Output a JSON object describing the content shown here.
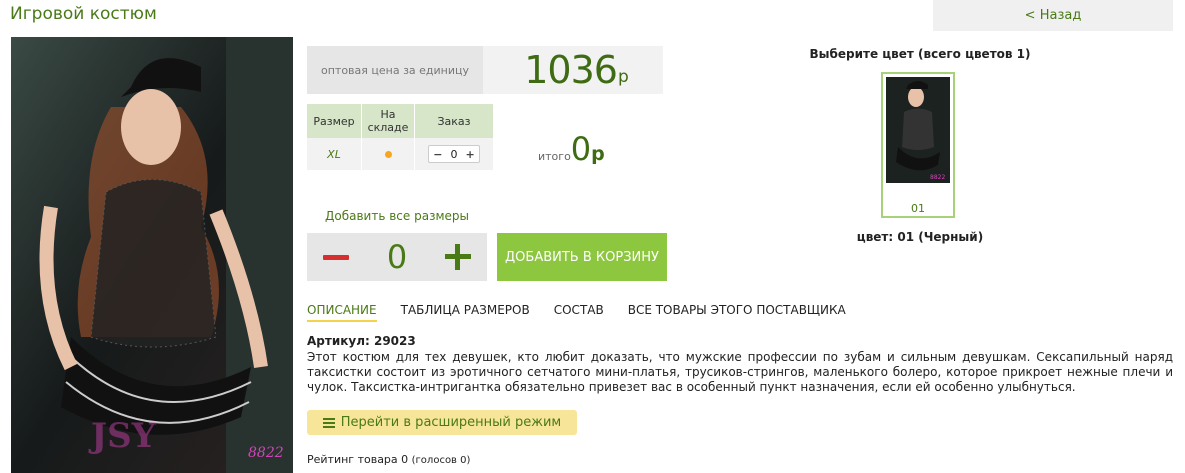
{
  "title": "Игровой костюм",
  "back_label": "< Назад",
  "price": {
    "label": "оптовая цена за единицу",
    "value": "1036",
    "currency": "р"
  },
  "sizes_table": {
    "headers": [
      "Размер",
      "На складе",
      "Заказ"
    ],
    "rows": [
      {
        "size": "XL",
        "qty": "0"
      }
    ]
  },
  "total": {
    "label": "итого",
    "value": "0",
    "currency": "р"
  },
  "add_all_sizes": "Добавить все размеры",
  "big_stepper_value": "0",
  "add_to_cart": "ДОБАВИТЬ В КОРЗИНУ",
  "color": {
    "heading": "Выберите цвет (всего цветов 1)",
    "swatch_code": "01",
    "selected": "цвет: 01 (Черный)"
  },
  "tabs": [
    "ОПИСАНИЕ",
    "ТАБЛИЦА РАЗМЕРОВ",
    "СОСТАВ",
    "ВСЕ ТОВАРЫ ЭТОГО ПОСТАВЩИКА"
  ],
  "article": "Артикул: 29023",
  "description": "Этот костюм для тех девушек, кто любит доказать, что мужские профессии по зубам и сильным девушкам. Сексапильный наряд таксистки состоит из эротичного сетчатого мини-платья, трусиков-стрингов, маленького болеро, которое прикроет нежные плечи и чулок. Таксистка-интригантка обязательно привезет вас в особенный пункт назначения, если ей особенно улыбнуться.",
  "advanced_mode": "Перейти в расширенный режим",
  "rating": {
    "text": "Рейтинг товара 0",
    "votes": "(голосов 0)"
  },
  "image_watermark": "8822",
  "colors": {
    "accent": "#4a7a16",
    "button": "#8dc63f",
    "minus": "#d62f2f",
    "yellow": "#f7e59a"
  }
}
